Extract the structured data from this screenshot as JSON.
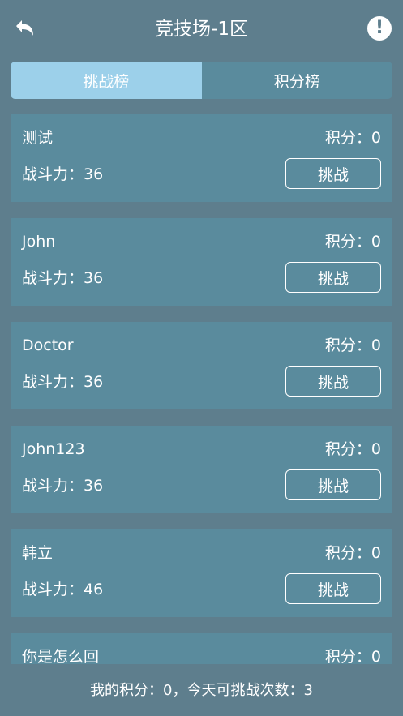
{
  "header": {
    "title": "竞技场-1区"
  },
  "tabs": [
    {
      "label": "挑战榜",
      "active": true
    },
    {
      "label": "积分榜",
      "active": false
    }
  ],
  "colors": {
    "background": "#5e7e8d",
    "card": "#5a8b9d",
    "active_tab": "#9cd0ea"
  },
  "players": [
    {
      "name": "测试",
      "score": "积分：0",
      "power": "战斗力：36",
      "button": "挑战"
    },
    {
      "name": "John",
      "score": "积分：0",
      "power": "战斗力：36",
      "button": "挑战"
    },
    {
      "name": "Doctor",
      "score": "积分：0",
      "power": "战斗力：36",
      "button": "挑战"
    },
    {
      "name": "John123",
      "score": "积分：0",
      "power": "战斗力：36",
      "button": "挑战"
    },
    {
      "name": "韩立",
      "score": "积分：0",
      "power": "战斗力：46",
      "button": "挑战"
    },
    {
      "name": "你是怎么回",
      "score": "积分：0",
      "power": "",
      "button": ""
    }
  ],
  "footer": {
    "text": "我的积分：0，今天可挑战次数：3"
  }
}
